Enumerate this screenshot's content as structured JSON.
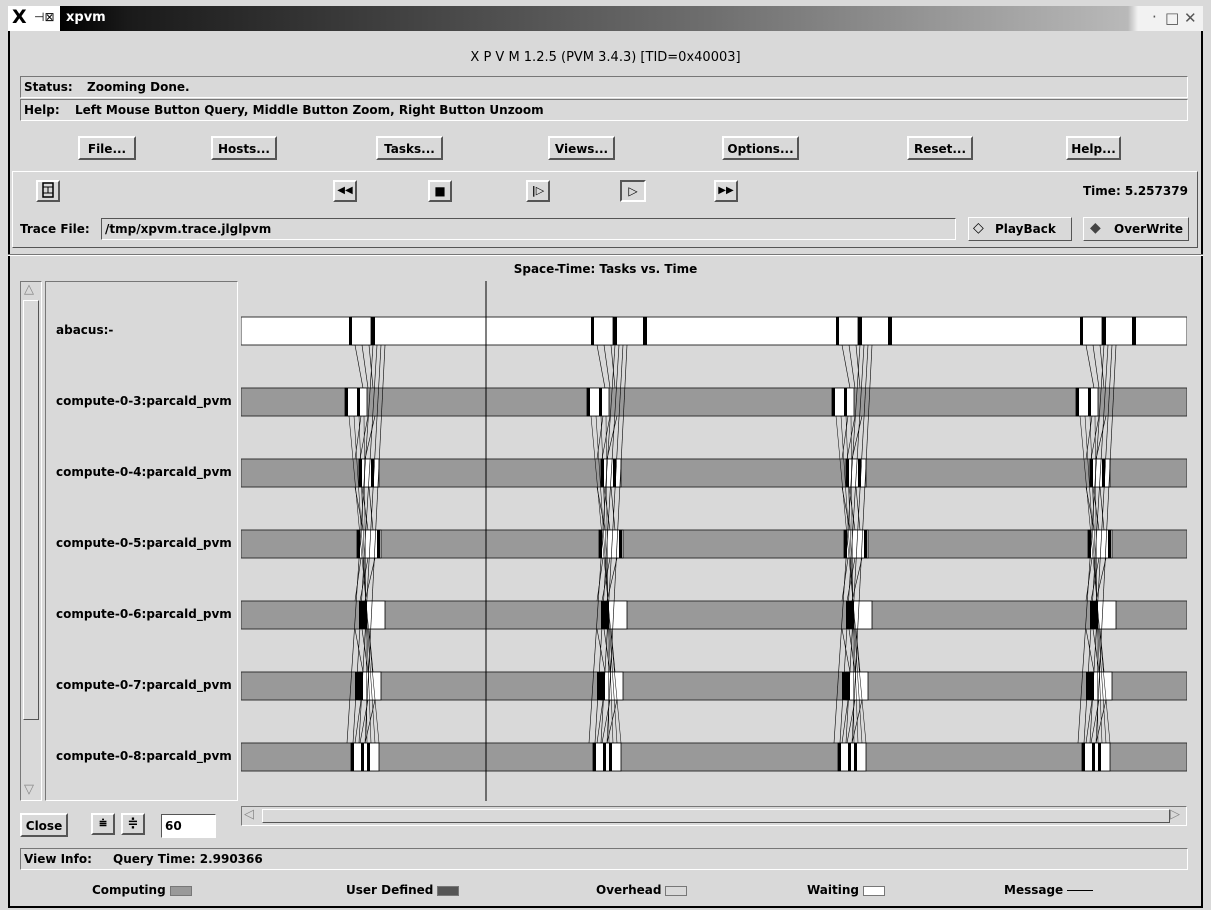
{
  "window": {
    "title": "xpvm",
    "title_glyph": "X",
    "pin_glyph": "⊣⊠",
    "controls": {
      "minimize": "·",
      "maximize": "□",
      "close": "✕"
    }
  },
  "header": {
    "app_title": "X P V M  1.2.5  (PVM 3.4.3)  [TID=0x40003]"
  },
  "status": {
    "label": "Status:",
    "text": "Zooming Done."
  },
  "help": {
    "label": "Help:",
    "text": "Left Mouse Button Query, Middle Button Zoom, Right Button Unzoom"
  },
  "menu": {
    "file": "File...",
    "hosts": "Hosts...",
    "tasks": "Tasks...",
    "views": "Views...",
    "options": "Options...",
    "reset": "Reset...",
    "help": "Help..."
  },
  "playback": {
    "rewind": "◀◀",
    "stop": "■",
    "step": "|▷",
    "play": "▷",
    "fast_forward": "▶▶",
    "time_label": "Time: 5.257379"
  },
  "trace": {
    "label": "Trace File:",
    "file": "/tmp/xpvm.trace.jlglpvm",
    "playback_label": "PlayBack",
    "overwrite_label": "OverWrite",
    "mode_selected": "OverWrite"
  },
  "spacetime": {
    "title": "Space-Time: Tasks vs. Time",
    "tasks": [
      {
        "name": "abacus:-"
      },
      {
        "name": "compute-0-3:parcald_pvm"
      },
      {
        "name": "compute-0-4:parcald_pvm"
      },
      {
        "name": "compute-0-5:parcald_pvm"
      },
      {
        "name": "compute-0-6:parcald_pvm"
      },
      {
        "name": "compute-0-7:parcald_pvm"
      },
      {
        "name": "compute-0-8:parcald_pvm"
      }
    ]
  },
  "zoom": {
    "close_label": "Close",
    "zoom_in_icon": "zoom-in-icon",
    "zoom_out_icon": "zoom-out-icon",
    "value": "60"
  },
  "view_info": {
    "label": "View Info:",
    "text": "Query Time: 2.990366"
  },
  "legend": {
    "computing": "Computing",
    "user_defined": "User Defined",
    "overhead": "Overhead",
    "waiting": "Waiting",
    "message": "Message"
  },
  "colors": {
    "background": "#d9d9d9",
    "computing": "#999999",
    "user_defined": "#555555",
    "overhead": "#d9d9d9",
    "waiting": "#ffffff",
    "message": "#000000"
  }
}
